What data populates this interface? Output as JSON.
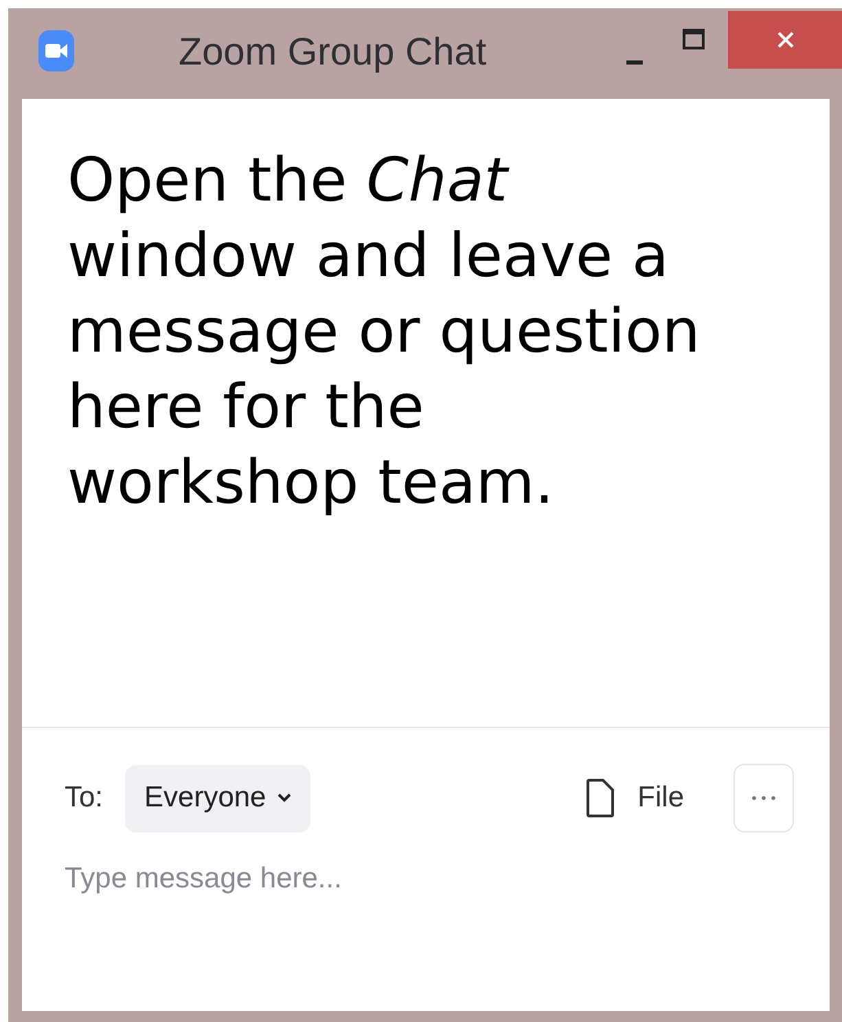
{
  "window": {
    "title": "Zoom Group Chat"
  },
  "message": "Open the *Chat* window and leave a message or question here for the workshop team.",
  "compose": {
    "to_label": "To:",
    "recipient": "Everyone",
    "file_label": "File",
    "placeholder": "Type message here..."
  }
}
